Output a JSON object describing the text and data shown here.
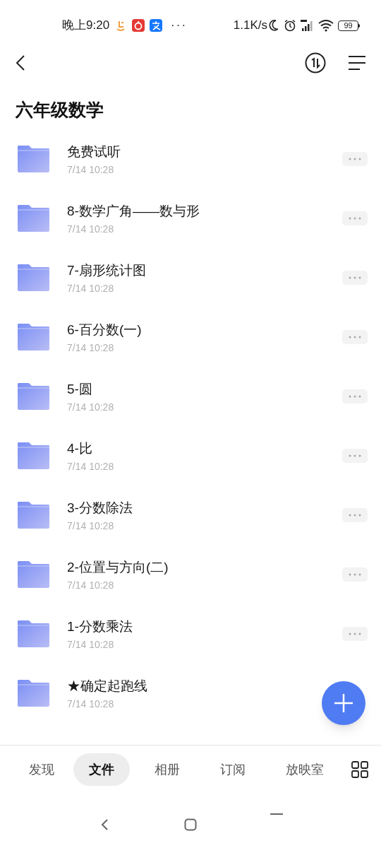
{
  "status_bar": {
    "time": "晚上9:20",
    "more": "···",
    "speed": "1.1K/s",
    "battery": "99"
  },
  "title": "六年级数学",
  "folders": [
    {
      "name": "免费试听",
      "date": "7/14 10:28"
    },
    {
      "name": "8-数学广角——数与形",
      "date": "7/14 10:28"
    },
    {
      "name": "7-扇形统计图",
      "date": "7/14 10:28"
    },
    {
      "name": "6-百分数(一)",
      "date": "7/14 10:28"
    },
    {
      "name": "5-圆",
      "date": "7/14 10:28"
    },
    {
      "name": "4-比",
      "date": "7/14 10:28"
    },
    {
      "name": "3-分数除法",
      "date": "7/14 10:28"
    },
    {
      "name": "2-位置与方向(二)",
      "date": "7/14 10:28"
    },
    {
      "name": "1-分数乘法",
      "date": "7/14 10:28"
    },
    {
      "name": "★确定起跑线",
      "date": "7/14 10:28"
    }
  ],
  "tabs": [
    {
      "label": "发现",
      "selected": false
    },
    {
      "label": "文件",
      "selected": true
    },
    {
      "label": "相册",
      "selected": false
    },
    {
      "label": "订阅",
      "selected": false
    },
    {
      "label": "放映室",
      "selected": false
    }
  ]
}
